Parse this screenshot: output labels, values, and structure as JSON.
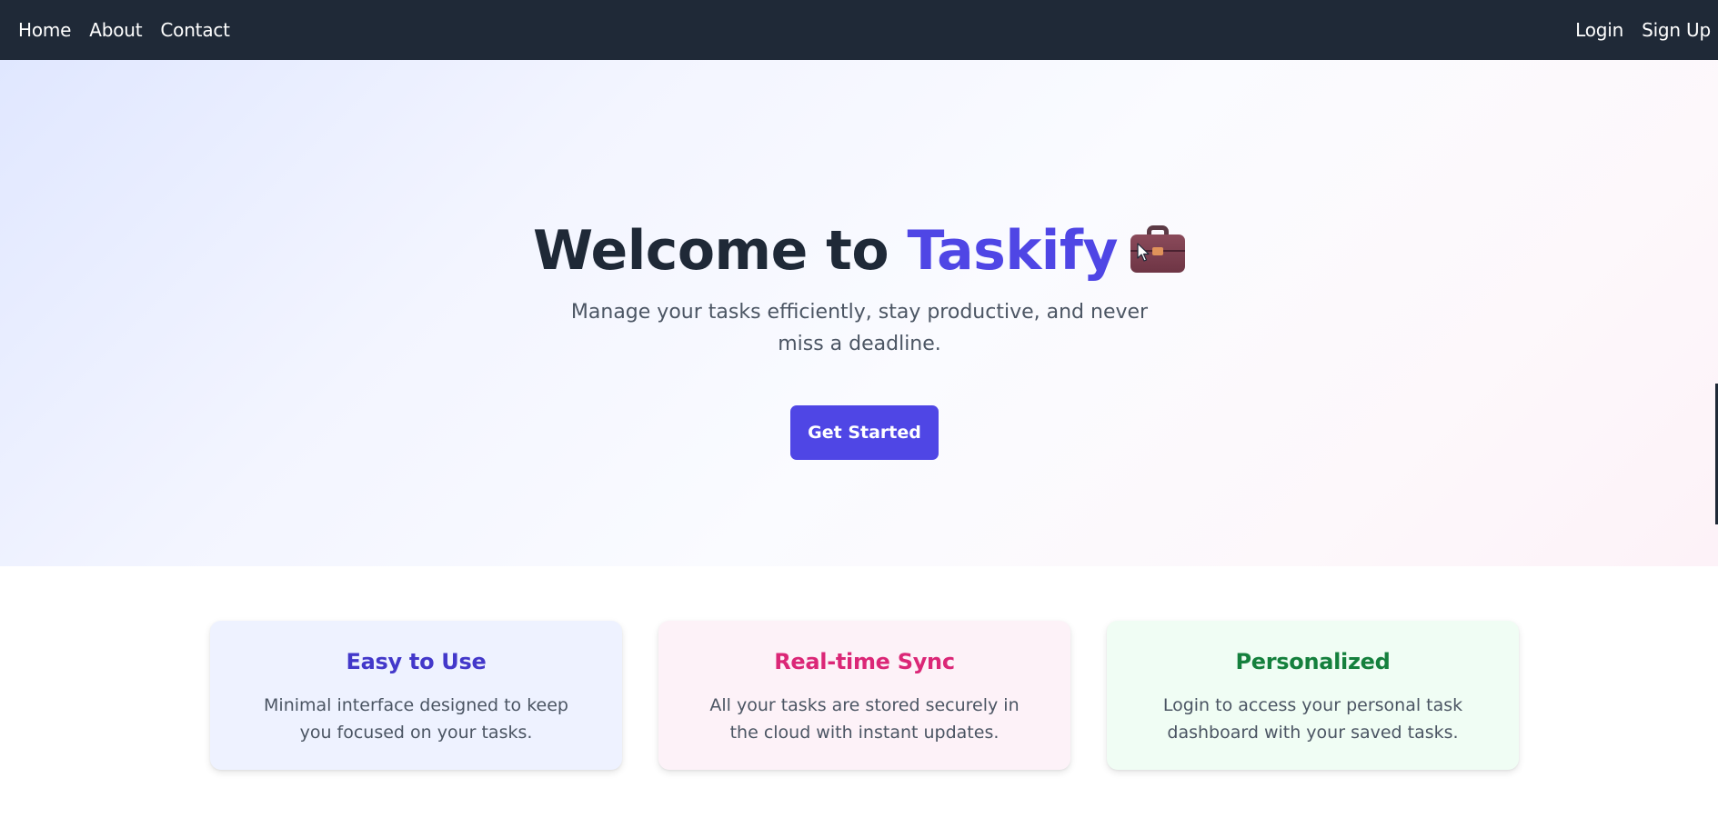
{
  "nav": {
    "home": "Home",
    "about": "About",
    "contact": "Contact",
    "login": "Login",
    "signup": "Sign Up"
  },
  "hero": {
    "title_prefix": "Welcome to",
    "brand": "Taskify",
    "icon": "briefcase-icon",
    "subtitle": "Manage your tasks efficiently, stay productive, and never miss a deadline.",
    "cta_label": "Get Started"
  },
  "features": [
    {
      "title": "Easy to Use",
      "text": "Minimal interface designed to keep you focused on your tasks.",
      "color": "#4338ca",
      "background": "#eef2ff"
    },
    {
      "title": "Real-time Sync",
      "text": "All your tasks are stored securely in the cloud with instant updates.",
      "color": "#db2777",
      "background": "#fdf2f8"
    },
    {
      "title": "Personalized",
      "text": "Login to access your personal task dashboard with your saved tasks.",
      "color": "#15803d",
      "background": "#f0fdf4"
    }
  ],
  "colors": {
    "navbar": "#1f2937",
    "accent": "#4f46e5",
    "heading": "#1f2937",
    "body_text": "#4b5563"
  }
}
